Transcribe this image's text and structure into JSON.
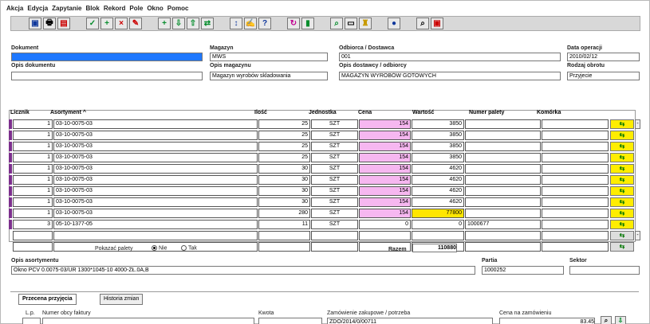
{
  "menu": [
    "Akcja",
    "Edycja",
    "Zapytanie",
    "Blok",
    "Rekord",
    "Pole",
    "Okno",
    "Pomoc"
  ],
  "toolbar": {
    "icons": [
      "save-icon",
      "print-icon",
      "form-icon",
      "check-icon",
      "add-icon",
      "delete-icon",
      "tool-icon",
      "add-row-icon",
      "import-icon",
      "export-icon",
      "split-icon",
      "sort-icon",
      "help-icon",
      "refresh-icon",
      "exit-icon",
      "query-icon",
      "save-as-icon",
      "globe-icon",
      "search-icon",
      "window-icon"
    ]
  },
  "header": {
    "document_label": "Dokument",
    "document_value": "",
    "warehouse_label": "Magazyn",
    "warehouse_value": "MWS",
    "client_label": "Odbiorca / Dostawca",
    "client_value": "001",
    "date_label": "Data operacji",
    "date_value": "2010/02/12",
    "doc_desc_label": "Opis dokumentu",
    "warehouse_desc_label": "Opis magazynu",
    "warehouse_desc_value": "Magazyn wyrobów skladowania",
    "client_desc_label": "Opis dostawcy / odbiorcy",
    "client_desc_value": "MAGAZYN WYROBÓW GOTOWYCH",
    "turnover_label": "Rodzaj obrotu",
    "turnover_value": "Przyjecie"
  },
  "table": {
    "columns": [
      "Licznik",
      "Asortyment ^",
      "Ilość",
      "Jednostka",
      "Cena",
      "Wartość",
      "Numer palety",
      "Komórka"
    ],
    "rows": [
      {
        "count": "1",
        "sku": "03-10-0075-03",
        "qty": "25",
        "unit": "SZT",
        "price": "154",
        "value": "3850",
        "pallet": "",
        "cell": ""
      },
      {
        "count": "1",
        "sku": "03-10-0075-03",
        "qty": "25",
        "unit": "SZT",
        "price": "154",
        "value": "3850",
        "pallet": "",
        "cell": ""
      },
      {
        "count": "1",
        "sku": "03-10-0075-03",
        "qty": "25",
        "unit": "SZT",
        "price": "154",
        "value": "3850",
        "pallet": "",
        "cell": ""
      },
      {
        "count": "1",
        "sku": "03-10-0075-03",
        "qty": "25",
        "unit": "SZT",
        "price": "154",
        "value": "3850",
        "pallet": "",
        "cell": ""
      },
      {
        "count": "1",
        "sku": "03-10-0075-03",
        "qty": "30",
        "unit": "SZT",
        "price": "154",
        "value": "4620",
        "pallet": "",
        "cell": ""
      },
      {
        "count": "1",
        "sku": "03-10-0075-03",
        "qty": "30",
        "unit": "SZT",
        "price": "154",
        "value": "4620",
        "pallet": "",
        "cell": ""
      },
      {
        "count": "1",
        "sku": "03-10-0075-03",
        "qty": "30",
        "unit": "SZT",
        "price": "154",
        "value": "4620",
        "pallet": "",
        "cell": ""
      },
      {
        "count": "1",
        "sku": "03-10-0075-03",
        "qty": "30",
        "unit": "SZT",
        "price": "154",
        "value": "4620",
        "pallet": "",
        "cell": ""
      },
      {
        "count": "1",
        "sku": "03-10-0075-03",
        "qty": "280",
        "unit": "SZT",
        "price": "154",
        "value": "77800",
        "pallet": "",
        "cell": ""
      },
      {
        "count": "3",
        "sku": "05-10-1377-05",
        "qty": "11",
        "unit": "SZT",
        "price": "0",
        "value": "0",
        "pallet": "1000677",
        "cell": ""
      }
    ]
  },
  "footer": {
    "show_pallets_label": "Pokazać palety",
    "radio_no": "Nie",
    "radio_yes": "Tak",
    "sum_label": "Razem",
    "sum_value": "110880",
    "assortment_desc_label": "Opis asortymentu",
    "assortment_desc_value": "Okno PCV 0.0075-03/UR 1300*1045-10 4000-ZŁ.0A,B",
    "batch_label": "Partia",
    "batch_value": "1000252",
    "sector_label": "Sektor",
    "sector_value": ""
  },
  "tabs": [
    "Przecena przyjęcia",
    "Historia zmian"
  ],
  "bottom": {
    "lp_label": "L.p.",
    "invoice_label": "Numer obcy faktury",
    "amount_label": "Kwota",
    "order_label": "Zamówienie zakupowe / potrzeba",
    "order_value": "ZDO/2014/0/00711",
    "price_label": "Cena na zamówieniu",
    "price_value": "83.45"
  }
}
